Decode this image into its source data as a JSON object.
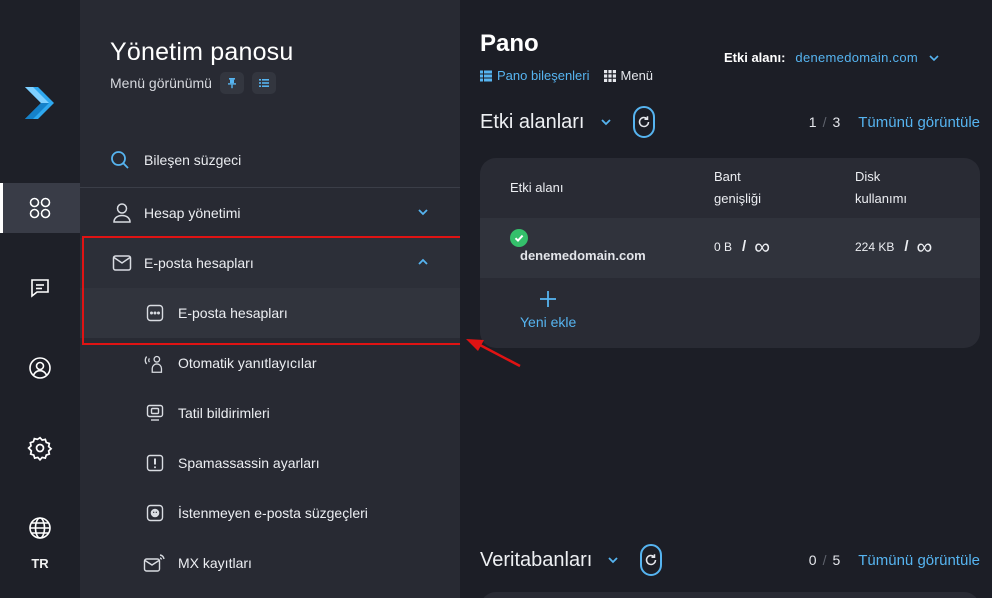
{
  "rail": {
    "language": "TR"
  },
  "panel": {
    "title": "Yönetim panosu",
    "subtitle": "Menü görünümü",
    "filter_label": "Bileşen süzgeci",
    "items": [
      {
        "label": "Hesap yönetimi"
      },
      {
        "label": "E-posta hesapları"
      }
    ],
    "sub_items": [
      {
        "label": "E-posta hesapları"
      },
      {
        "label": "Otomatik yanıtlayıcılar"
      },
      {
        "label": "Tatil bildirimleri"
      },
      {
        "label": "Spamassassin ayarları"
      },
      {
        "label": "İstenmeyen e-posta süzgeçleri"
      },
      {
        "label": "MX kayıtları"
      }
    ]
  },
  "main": {
    "title": "Pano",
    "view_links": {
      "widgets": "Pano bileşenleri",
      "menu": "Menü"
    },
    "domain_selector": {
      "label": "Etki alanı:",
      "value": "denemedomain.com"
    },
    "domains_section": {
      "title": "Etki alanları",
      "count_current": "1",
      "count_sep": "/",
      "count_total": "3",
      "view_all": "Tümünü görüntüle",
      "columns": {
        "domain": "Etki alanı",
        "bandwidth_line1": "Bant",
        "bandwidth_line2": "genişliği",
        "disk_line1": "Disk",
        "disk_line2": "kullanımı"
      },
      "rows": [
        {
          "domain": "denemedomain.com",
          "bandwidth_used": "0 B",
          "disk_used": "224 KB",
          "slash": "/",
          "infinity": "∞"
        }
      ],
      "add_label": "Yeni ekle"
    },
    "databases_section": {
      "title": "Veritabanları",
      "count_current": "0",
      "count_sep": "/",
      "count_total": "5",
      "view_all": "Tümünü görüntüle"
    }
  },
  "colors": {
    "accent": "#56b4f0",
    "highlight": "#e01313",
    "success": "#34c06b"
  }
}
